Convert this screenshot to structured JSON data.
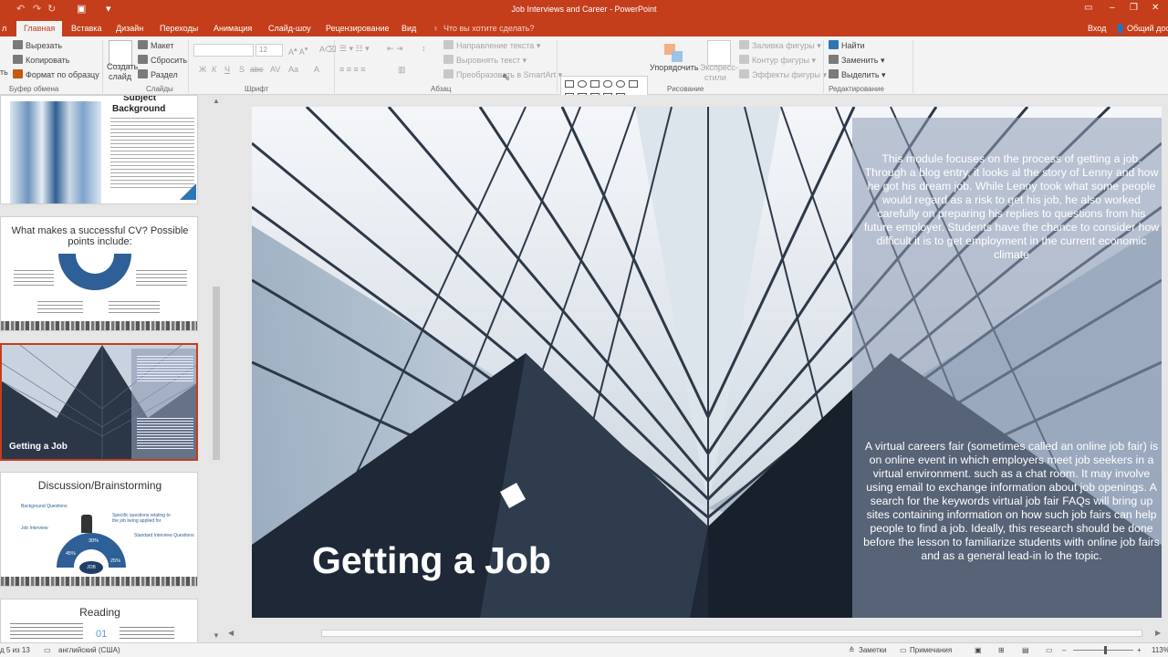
{
  "window": {
    "title": "Job Interviews and Career - PowerPoint",
    "sign_in": "Вход",
    "share": "Общий дос"
  },
  "tabs": [
    "л",
    "Главная",
    "Вставка",
    "Дизайн",
    "Переходы",
    "Анимация",
    "Слайд-шоу",
    "Рецензирование",
    "Вид"
  ],
  "tell_me": "Что вы хотите сделать?",
  "ribbon": {
    "clipboard": {
      "cut": "Вырезать",
      "copy": "Копировать",
      "format_painter": "Формат по образцу",
      "label": "Буфер обмена",
      "paste_partial": "ть"
    },
    "slides": {
      "new_slide_line1": "Создать",
      "new_slide_line2": "слайд",
      "layout": "Макет",
      "reset": "Сбросить",
      "section": "Раздел",
      "label": "Слайды"
    },
    "font": {
      "size": "12",
      "label": "Шрифт",
      "buttons": [
        "Ж",
        "К",
        "Ч",
        "S",
        "abc",
        "AV",
        "Aa",
        "A"
      ]
    },
    "paragraph": {
      "text_direction": "Направление текста",
      "align_text": "Выровнять текст",
      "convert_smartart": "Преобразовать в SmartArt",
      "label": "Абзац"
    },
    "drawing": {
      "arrange": "Упорядочить",
      "quick_styles_line1": "Экспресс-",
      "quick_styles_line2": "стили",
      "shape_fill": "Заливка фигуры",
      "shape_outline": "Контур фигуры",
      "shape_effects": "Эффекты фигуры",
      "label": "Рисование"
    },
    "editing": {
      "find": "Найти",
      "replace": "Заменить",
      "select": "Выделить",
      "label": "Редактирование"
    }
  },
  "thumbnails": [
    {
      "title_line1": "Subject",
      "title_line2": "Background"
    },
    {
      "title": "What makes a successful CV? Possible points include:"
    },
    {
      "title": "Getting a Job",
      "selected": true
    },
    {
      "title": "Discussion/Brainstorming",
      "pcts": [
        "30%",
        "45%",
        "25%"
      ],
      "center": "JOB",
      "label_a": "Background Questions",
      "label_b": "Specific questions relating to the job being applied for",
      "label_c": "Job Interview",
      "label_d": "Standard Interview Questions"
    },
    {
      "title": "Reading",
      "number": "01"
    }
  ],
  "slide": {
    "title": "Getting a Job",
    "paragraph1": "This module focuses on the process of getting a job. Through a blog entry, it looks al the story of Lenny and how he got his dream job. While Lenny took what some people would regard as a risk to get his job, he also worked carefully on preparing his replies to questions from his future employer. Students have the chance to consider how difficult it is to get employment in the current economic climate",
    "paragraph2": "A virtual careers fair (sometimes called an online job fair) is on online event in which employers meet job seekers in a virtual environment. such as a chat room. It may involve using email to exchange information about job openings. A search for the keywords virtual job fair FAQs will bring up sites containing information on how such job fairs can help people to find a job. Ideally, this research should be done before the lesson to familiarize students with online job fairs and as a general lead-in lo the topic."
  },
  "status": {
    "slide_counter": "д 5 из 13",
    "language": "английский (США)",
    "notes": "Заметки",
    "comments": "Примечания",
    "zoom": "113%"
  },
  "colors": {
    "accent": "#c43e1c",
    "ribbon": "#f3f3f3",
    "workspace": "#e6e6e6"
  }
}
